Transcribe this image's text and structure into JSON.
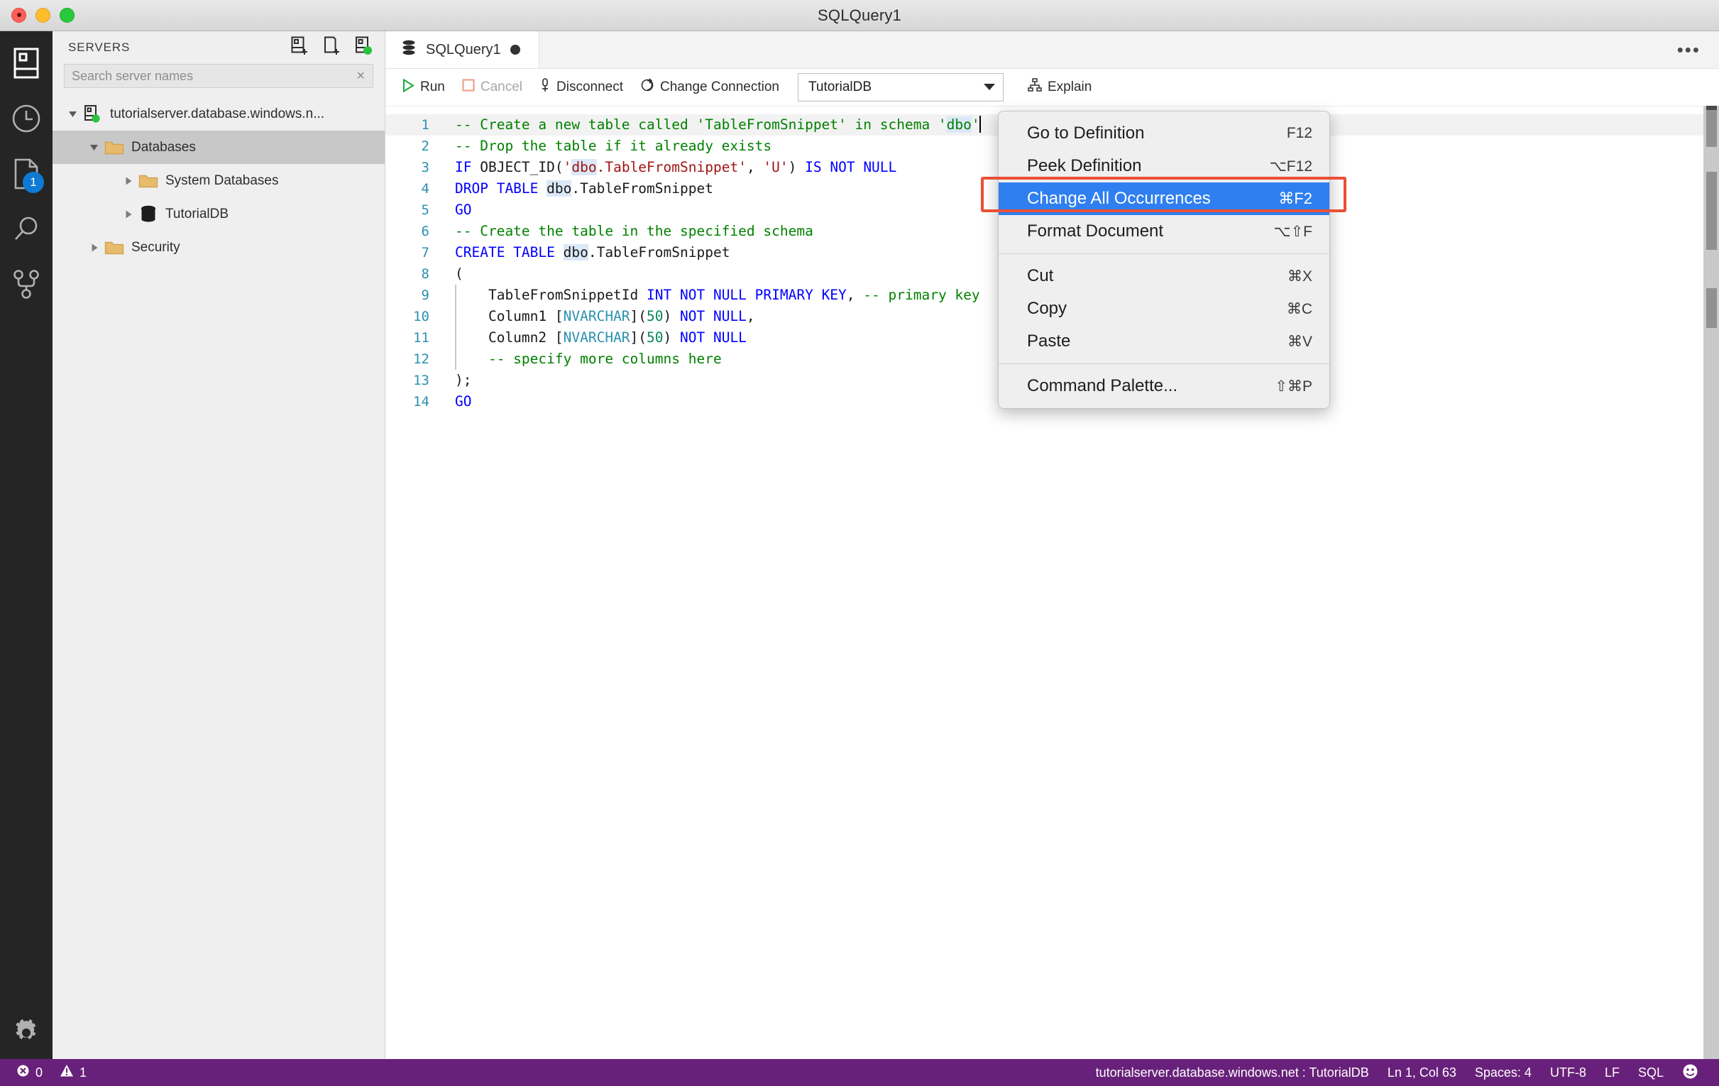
{
  "window": {
    "title": "SQLQuery1",
    "traffic_lights": [
      "close",
      "minimize",
      "zoom"
    ]
  },
  "activity_bar": {
    "items": [
      {
        "icon": "servers-icon",
        "name": "servers",
        "badge": null
      },
      {
        "icon": "history-clock-icon",
        "name": "query-history",
        "badge": null
      },
      {
        "icon": "file-page-icon",
        "name": "open-editors",
        "badge": "1"
      },
      {
        "icon": "search-magnifier-icon",
        "name": "search",
        "badge": null
      },
      {
        "icon": "source-control-branch-icon",
        "name": "source-control",
        "badge": null
      }
    ],
    "bottom": {
      "icon": "gear-icon",
      "name": "manage-settings"
    }
  },
  "sidebar": {
    "title": "SERVERS",
    "actions": [
      {
        "name": "new-connection-icon",
        "title": "New Connection"
      },
      {
        "name": "new-query-icon",
        "title": "New Query"
      },
      {
        "name": "new-server-group-icon",
        "title": "New Server Group"
      }
    ],
    "search": {
      "placeholder": "Search server names",
      "value": "",
      "clear_label": "×"
    },
    "tree": [
      {
        "label": "tutorialserver.database.windows.n...",
        "level": 0,
        "icon": "server-connected-icon",
        "expanded": true,
        "selected": false
      },
      {
        "label": "Databases",
        "level": 1,
        "icon": "folder-icon",
        "expanded": true,
        "selected": true
      },
      {
        "label": "System Databases",
        "level": 2,
        "icon": "folder-icon",
        "expanded": false,
        "selected": false
      },
      {
        "label": "TutorialDB",
        "level": 2,
        "icon": "database-icon",
        "expanded": false,
        "selected": false
      },
      {
        "label": "Security",
        "level": 1,
        "icon": "folder-icon",
        "expanded": false,
        "selected": false
      }
    ]
  },
  "editor": {
    "tab": {
      "label": "SQLQuery1",
      "icon": "database-icon",
      "dirty": true
    },
    "more_actions": "•••",
    "toolbar": {
      "run": "Run",
      "cancel": "Cancel",
      "disconnect": "Disconnect",
      "change_connection": "Change Connection",
      "database_selected": "TutorialDB",
      "explain": "Explain"
    },
    "lines": [
      {
        "n": "1",
        "highlight": true,
        "tokens": [
          {
            "t": "-- Create a new table called 'TableFromSnippet' in schema '",
            "c": "cmt"
          },
          {
            "t": "dbo",
            "c": "cmt occ"
          },
          {
            "t": "'",
            "c": "cmt"
          },
          {
            "t": "",
            "c": "caret"
          }
        ]
      },
      {
        "n": "2",
        "tokens": [
          {
            "t": "-- Drop the table if it already exists",
            "c": "cmt"
          }
        ]
      },
      {
        "n": "3",
        "tokens": [
          {
            "t": "IF",
            "c": "kw"
          },
          {
            "t": " OBJECT_ID(",
            "c": "plain"
          },
          {
            "t": "'",
            "c": "str"
          },
          {
            "t": "dbo",
            "c": "str occ"
          },
          {
            "t": ".TableFromSnippet'",
            "c": "str"
          },
          {
            "t": ", ",
            "c": "plain"
          },
          {
            "t": "'U'",
            "c": "str"
          },
          {
            "t": ") ",
            "c": "plain"
          },
          {
            "t": "IS NOT NULL",
            "c": "kw"
          }
        ]
      },
      {
        "n": "4",
        "tokens": [
          {
            "t": "DROP TABLE",
            "c": "kw"
          },
          {
            "t": " ",
            "c": "plain"
          },
          {
            "t": "dbo",
            "c": "plain occ"
          },
          {
            "t": ".TableFromSnippet",
            "c": "plain"
          }
        ]
      },
      {
        "n": "5",
        "tokens": [
          {
            "t": "GO",
            "c": "kw"
          }
        ]
      },
      {
        "n": "6",
        "tokens": [
          {
            "t": "-- Create the table in the specified schema",
            "c": "cmt"
          }
        ]
      },
      {
        "n": "7",
        "tokens": [
          {
            "t": "CREATE TABLE",
            "c": "kw"
          },
          {
            "t": " ",
            "c": "plain"
          },
          {
            "t": "dbo",
            "c": "plain occ"
          },
          {
            "t": ".TableFromSnippet",
            "c": "plain"
          }
        ]
      },
      {
        "n": "8",
        "tokens": [
          {
            "t": "(",
            "c": "plain"
          }
        ]
      },
      {
        "n": "9",
        "tokens": [
          {
            "t": "    TableFromSnippetId ",
            "c": "plain"
          },
          {
            "t": "INT NOT NULL PRIMARY KEY",
            "c": "kw"
          },
          {
            "t": ", ",
            "c": "plain"
          },
          {
            "t": "-- primary key",
            "c": "cmt"
          }
        ]
      },
      {
        "n": "10",
        "tokens": [
          {
            "t": "    Column1 [",
            "c": "plain"
          },
          {
            "t": "NVARCHAR",
            "c": "type"
          },
          {
            "t": "](",
            "c": "plain"
          },
          {
            "t": "50",
            "c": "num"
          },
          {
            "t": ") ",
            "c": "plain"
          },
          {
            "t": "NOT NULL",
            "c": "kw"
          },
          {
            "t": ",",
            "c": "plain"
          }
        ]
      },
      {
        "n": "11",
        "tokens": [
          {
            "t": "    Column2 [",
            "c": "plain"
          },
          {
            "t": "NVARCHAR",
            "c": "type"
          },
          {
            "t": "](",
            "c": "plain"
          },
          {
            "t": "50",
            "c": "num"
          },
          {
            "t": ") ",
            "c": "plain"
          },
          {
            "t": "NOT NULL",
            "c": "kw"
          }
        ]
      },
      {
        "n": "12",
        "tokens": [
          {
            "t": "    -- specify more columns here",
            "c": "cmt"
          }
        ]
      },
      {
        "n": "13",
        "tokens": [
          {
            "t": ");",
            "c": "plain"
          }
        ]
      },
      {
        "n": "14",
        "tokens": [
          {
            "t": "GO",
            "c": "kw"
          }
        ]
      }
    ]
  },
  "context_menu": {
    "groups": [
      [
        {
          "label": "Go to Definition",
          "shortcut": "F12",
          "active": false
        },
        {
          "label": "Peek Definition",
          "shortcut": "⌥F12",
          "active": false
        },
        {
          "label": "Change All Occurrences",
          "shortcut": "⌘F2",
          "active": true
        },
        {
          "label": "Format Document",
          "shortcut": "⌥⇧F",
          "active": false
        }
      ],
      [
        {
          "label": "Cut",
          "shortcut": "⌘X",
          "active": false
        },
        {
          "label": "Copy",
          "shortcut": "⌘C",
          "active": false
        },
        {
          "label": "Paste",
          "shortcut": "⌘V",
          "active": false
        }
      ],
      [
        {
          "label": "Command Palette...",
          "shortcut": "⇧⌘P",
          "active": false
        }
      ]
    ],
    "highlight_color": "#ea4f35",
    "active_color": "#2f7ff0"
  },
  "status_bar": {
    "errors": "0",
    "warnings": "1",
    "connection": "tutorialserver.database.windows.net : TutorialDB",
    "cursor": "Ln 1, Col 63",
    "spaces": "Spaces: 4",
    "encoding": "UTF-8",
    "eol": "LF",
    "language": "SQL",
    "feedback": "☺",
    "background": "#68217a"
  }
}
